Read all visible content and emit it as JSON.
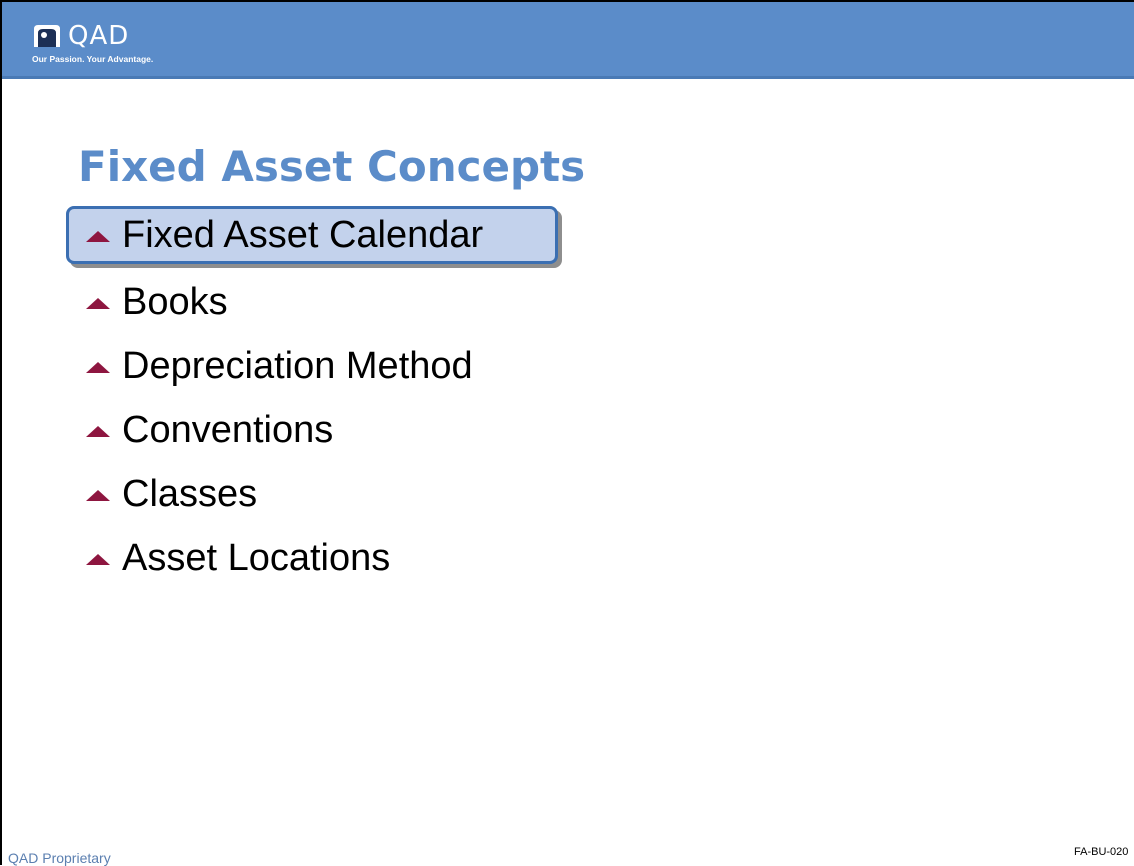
{
  "header": {
    "logo_text": "QAD",
    "tagline": "Our Passion. Your Advantage.",
    "background_color": "#5b8cc9"
  },
  "slide": {
    "title": "Fixed Asset Concepts",
    "title_color": "#5b8cc9",
    "bullet_icon": "triangle-up-icon",
    "bullet_color": "#8e1640",
    "bullets": [
      {
        "label": "Fixed Asset Calendar",
        "highlighted": true
      },
      {
        "label": "Books",
        "highlighted": false
      },
      {
        "label": "Depreciation Method",
        "highlighted": false
      },
      {
        "label": "Conventions",
        "highlighted": false
      },
      {
        "label": "Classes",
        "highlighted": false
      },
      {
        "label": "Asset Locations",
        "highlighted": false
      }
    ]
  },
  "footer": {
    "left_text": "QAD Proprietary",
    "right_text": "FA-BU-020"
  }
}
